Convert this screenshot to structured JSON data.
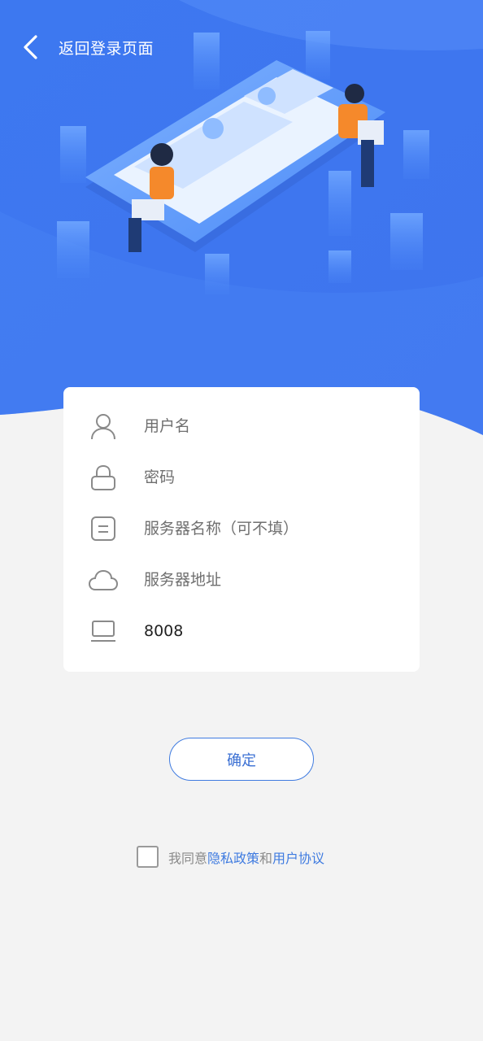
{
  "header": {
    "back_label": "返回登录页面"
  },
  "colors": {
    "hero_blue": "#3f7cf5",
    "accent": "#3f7be0",
    "background": "#f3f3f3"
  },
  "form": {
    "username": {
      "placeholder": "用户名",
      "value": "",
      "icon": "user-icon"
    },
    "password": {
      "placeholder": "密码",
      "value": "",
      "icon": "lock-icon"
    },
    "server_name": {
      "placeholder": "服务器名称（可不填）",
      "value": "",
      "icon": "server-name-icon"
    },
    "server_address": {
      "placeholder": "服务器地址",
      "value": "",
      "icon": "cloud-icon"
    },
    "port": {
      "placeholder": "",
      "value": "8008",
      "icon": "laptop-icon"
    }
  },
  "confirm_label": "确定",
  "agreement": {
    "prefix": "我同意",
    "privacy_link": "隐私政策",
    "conjunction": "和",
    "terms_link": "用户协议"
  }
}
